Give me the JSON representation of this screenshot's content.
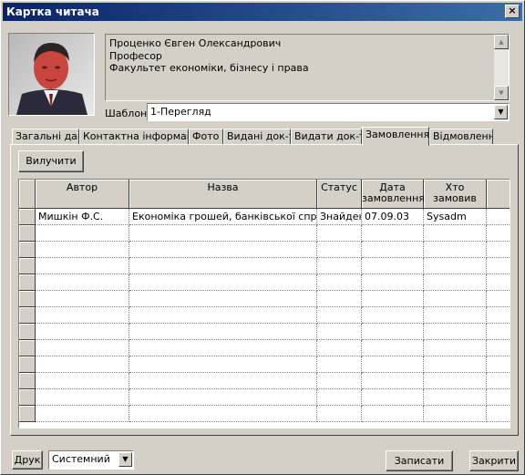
{
  "window": {
    "title": "Картка читача",
    "close_label": "×"
  },
  "reader": {
    "name": "Проценко Євген Олександрович",
    "position": "Професор",
    "faculty": "Факультет економіки, бізнесу і права"
  },
  "template": {
    "label": "Шаблон",
    "value": "1-Перегляд"
  },
  "tabs": [
    {
      "label": "Загальні дані",
      "active": false
    },
    {
      "label": "Контактна інформація",
      "active": false
    },
    {
      "label": "Фото",
      "active": false
    },
    {
      "label": "Видані док-ти",
      "active": false
    },
    {
      "label": "Видати док-ти",
      "active": false
    },
    {
      "label": "Замовлення",
      "active": true
    },
    {
      "label": "Відмовлення",
      "active": false
    }
  ],
  "orders": {
    "remove_label": "Вилучити",
    "columns": [
      "Автор",
      "Назва",
      "Статус",
      "Дата замовлення",
      "Хто замовив"
    ],
    "rows": [
      {
        "author": "Мишкін Ф.С.",
        "title": "Економіка грошей, банківської справи",
        "status": "Знайдено",
        "date": "07.09.03",
        "ordered_by": "Sysadm"
      }
    ]
  },
  "footer": {
    "print_label": "Друк",
    "print_mode": "Системний",
    "save_label": "Записати",
    "close_label": "Закрити"
  },
  "colors": {
    "title_bar": "#0a246a",
    "face": "#d4d0c8"
  }
}
